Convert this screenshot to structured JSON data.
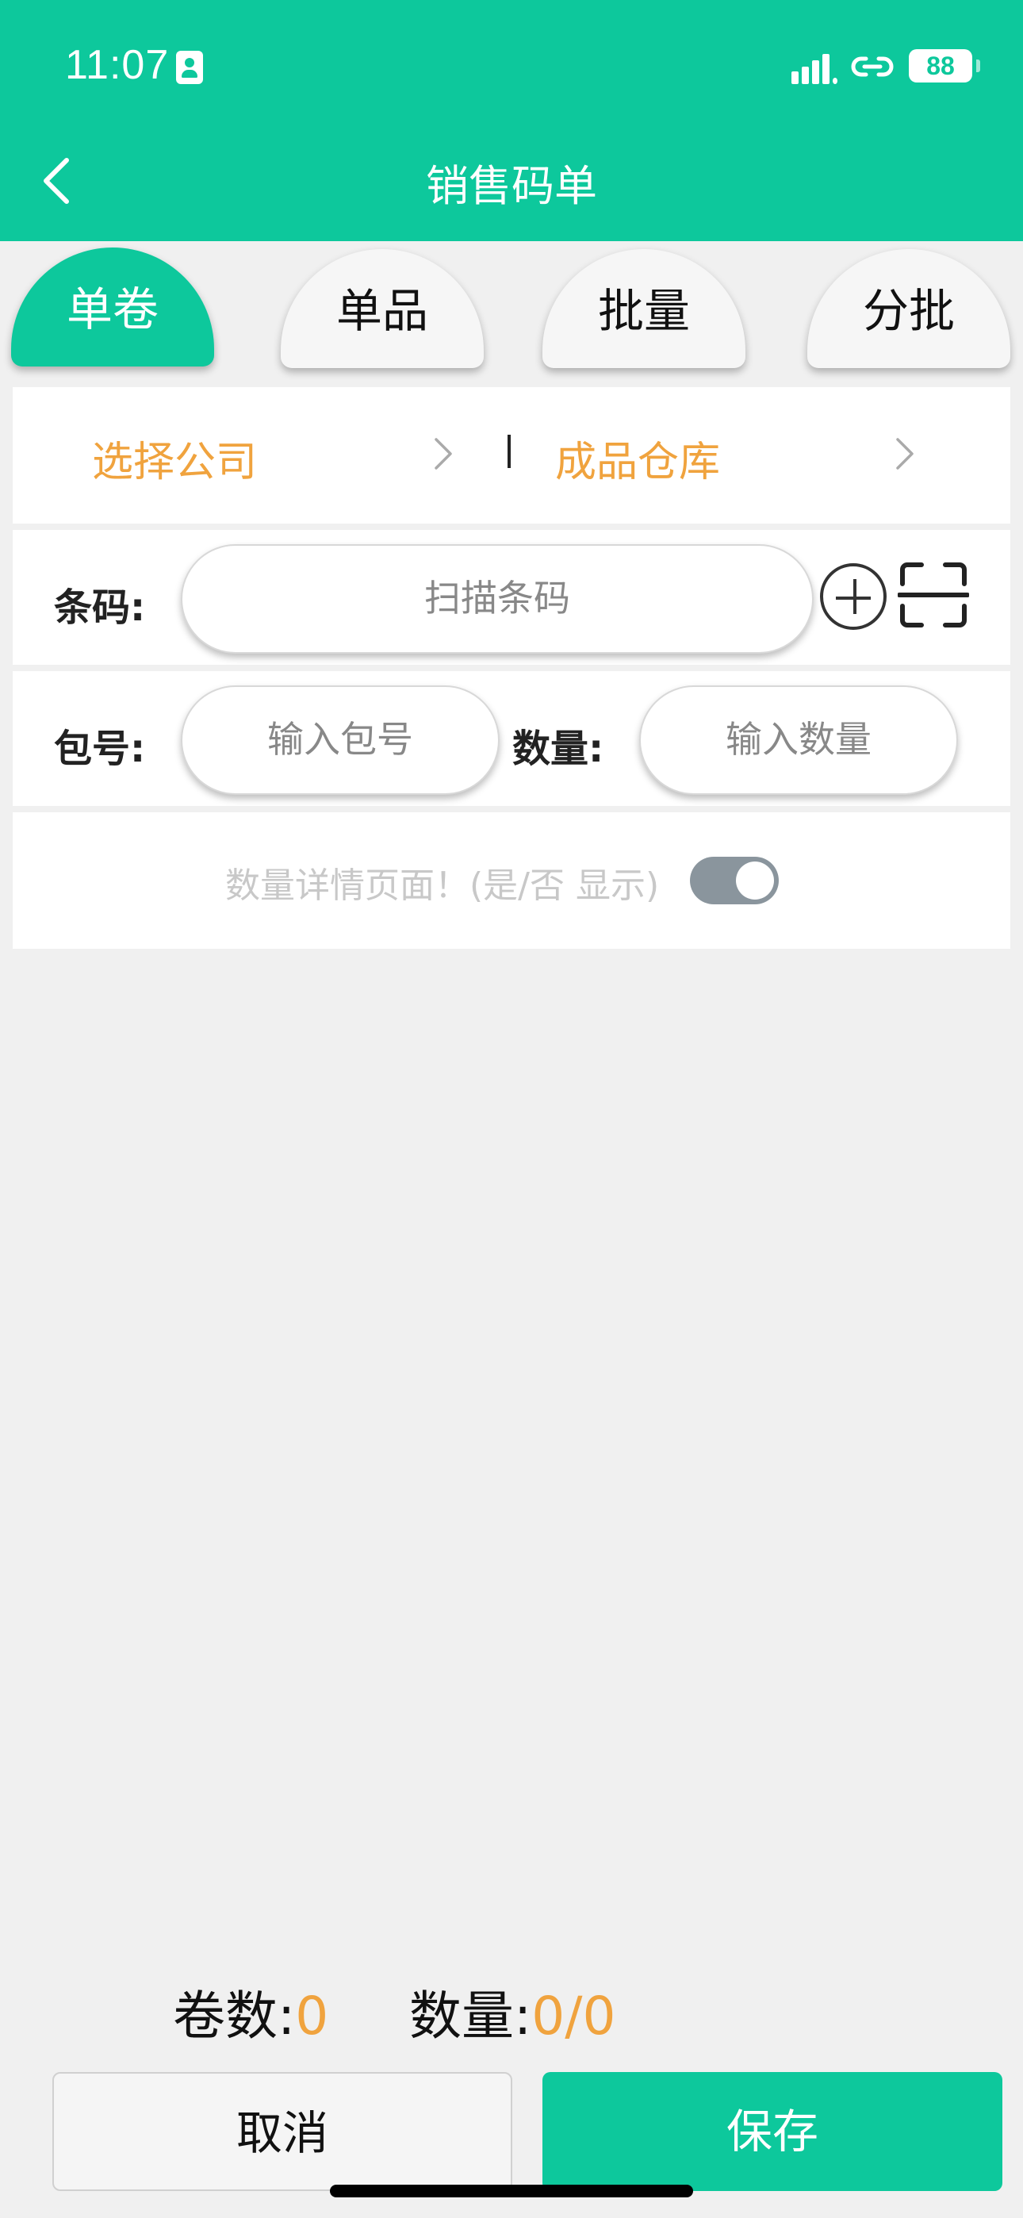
{
  "status_bar": {
    "time": "11:07",
    "battery": "88",
    "icons": [
      "id-card-icon",
      "signal-icon",
      "link-icon",
      "battery-icon"
    ]
  },
  "header": {
    "title": "销售码单",
    "back_icon": "chevron-left-icon"
  },
  "tabs": [
    {
      "label": "单卷",
      "active": true
    },
    {
      "label": "单品",
      "active": false
    },
    {
      "label": "批量",
      "active": false
    },
    {
      "label": "分批",
      "active": false
    }
  ],
  "selectors": {
    "company": "选择公司",
    "warehouse": "成品仓库",
    "separator": "|"
  },
  "barcode": {
    "label": "条码:",
    "placeholder": "扫描条码"
  },
  "package": {
    "label": "包号:",
    "placeholder": "输入包号"
  },
  "quantity": {
    "label": "数量:",
    "placeholder": "输入数量"
  },
  "toggle": {
    "label": "数量详情页面！(是/否 显示)",
    "on": true
  },
  "totals": {
    "rolls_label": "卷数:",
    "rolls_value": "0",
    "qty_label": "数量:",
    "qty_value": "0/0"
  },
  "buttons": {
    "cancel": "取消",
    "save": "保存"
  },
  "colors": {
    "brand": "#0dc89c",
    "accent": "#f0a33e"
  }
}
